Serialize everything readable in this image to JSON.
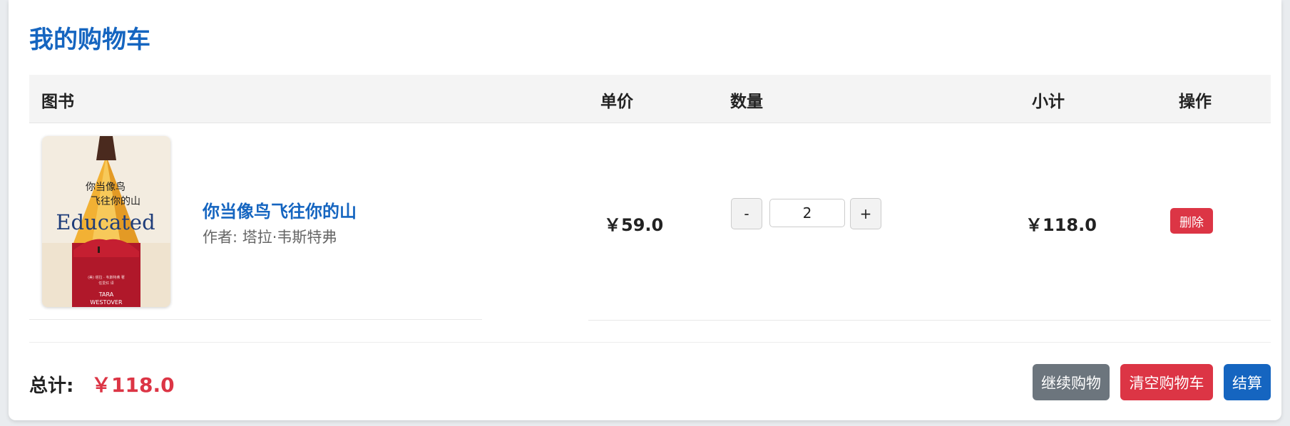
{
  "page_title": "我的购物车",
  "table": {
    "headers": {
      "book": "图书",
      "unit_price": "单价",
      "quantity": "数量",
      "subtotal": "小计",
      "actions": "操作"
    }
  },
  "items": [
    {
      "name": "你当像鸟飞往你的山",
      "author": "作者: 塔拉·韦斯特弗",
      "unit_price": "￥59.0",
      "quantity": "2",
      "subtotal": "￥118.0",
      "delete_label": "删除",
      "decrement_label": "-",
      "increment_label": "+",
      "cover": {
        "title_line1": "你当像鸟",
        "title_line2": "飞往你的山",
        "english_title": "Educated",
        "credit_line1": "(美) 塔拉 · 韦斯特弗 著",
        "credit_line2": "任爱红 译",
        "author_line1": "TARA",
        "author_line2": "WESTOVER"
      }
    }
  ],
  "footer": {
    "total_label": "总计:",
    "total_value": "￥118.0",
    "continue_label": "继续购物",
    "clear_label": "清空购物车",
    "checkout_label": "结算"
  },
  "colors": {
    "primary": "#1565c0",
    "danger": "#dc3545",
    "secondary": "#6c757d",
    "header_bg": "#f4f4f4"
  }
}
